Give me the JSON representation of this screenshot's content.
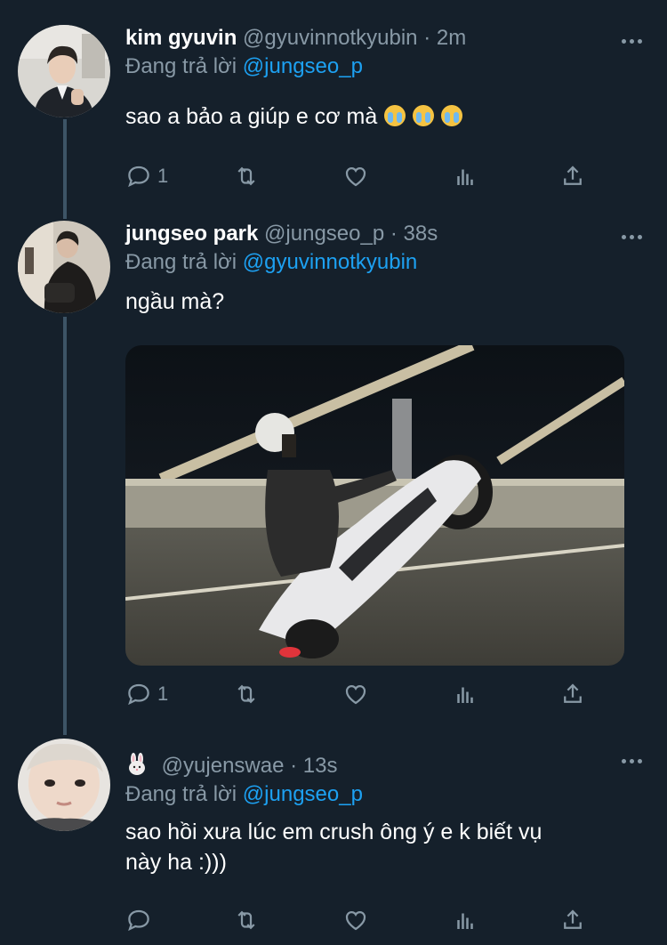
{
  "tweets": [
    {
      "display_name": "kim gyuvin",
      "handle": "@gyuvinnotkyubin",
      "separator": "·",
      "time": "2m",
      "reply_prefix": "Đang trả lời",
      "reply_to": "@jungseo_p",
      "text": "sao a bảo a giúp e cơ mà",
      "emojis": [
        "loudly-crying-face",
        "loudly-crying-face",
        "loudly-crying-face"
      ],
      "reply_count": "1"
    },
    {
      "display_name": "jungseo park",
      "handle": "@jungseo_p",
      "separator": "·",
      "time": "38s",
      "reply_prefix": "Đang trả lời",
      "reply_to": "@gyuvinnotkyubin",
      "text": "ngầu mà?",
      "media": "video-still: person doing a motorcycle wheelie on a bridge at night",
      "reply_count": "1"
    },
    {
      "display_name_icon": "rabbit-emoji",
      "handle": "@yujenswae",
      "separator": "·",
      "time": "13s",
      "reply_prefix": "Đang trả lời",
      "reply_to": "@jungseo_p",
      "text_line1": "sao hồi xưa lúc em crush ông ý e k biết vụ",
      "text_line2": "này ha :)))",
      "reply_count": ""
    }
  ],
  "icons": {
    "reply": "reply-icon",
    "retweet": "retweet-icon",
    "like": "heart-icon",
    "analytics": "analytics-icon",
    "share": "share-icon",
    "more": "more-icon"
  },
  "colors": {
    "background": "#15202b",
    "muted": "#8899a6",
    "accent": "#1da1f2",
    "thread_line": "#3d5466"
  }
}
